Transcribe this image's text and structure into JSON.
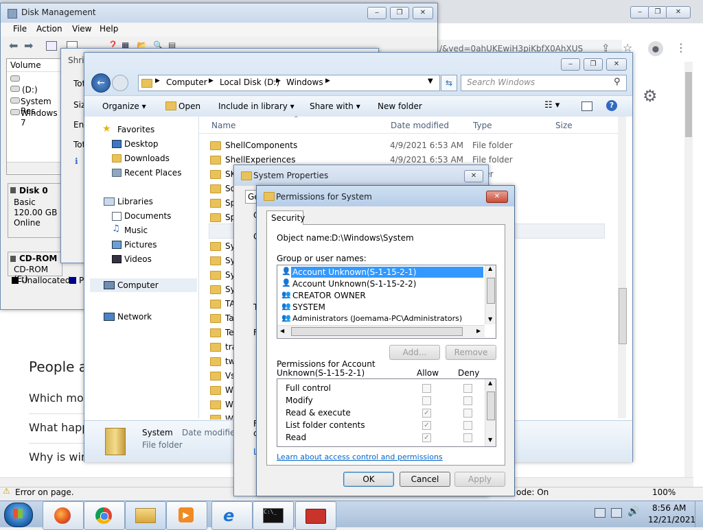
{
  "browser": {
    "url_fragment": "/&ved=0ahUKEwiH3piKbfX0AhXUS",
    "people_heading": "People a",
    "questions": [
      "Which mon",
      "What happe",
      "Why is wint"
    ],
    "status_left": "Error on page.",
    "status_right": "ode: On",
    "zoom": "100%"
  },
  "disk_mgmt": {
    "title": "Disk Management",
    "menu": [
      "File",
      "Action",
      "View",
      "Help"
    ],
    "volume_header": "Volume",
    "volumes": [
      "",
      "(D:)",
      "System Res",
      "Windows 7"
    ],
    "disk0": {
      "name": "Disk 0",
      "type": "Basic",
      "size": "120.00 GB",
      "status": "Online"
    },
    "cdrom": {
      "name": "CD-ROM",
      "drive": "CD-ROM (E:)"
    },
    "legend": [
      "Unallocated",
      "P"
    ]
  },
  "shrink": {
    "title": "Shri",
    "labels": [
      "Tot",
      "Size",
      "Ent",
      "Tot"
    ]
  },
  "explorer": {
    "path": [
      "Computer",
      "Local Disk (D:)",
      "Windows"
    ],
    "search_placeholder": "Search Windows",
    "toolbar": {
      "organize": "Organize",
      "open": "Open",
      "include": "Include in library",
      "share": "Share with",
      "new_folder": "New folder"
    },
    "nav": {
      "favorites": "Favorites",
      "fav_items": [
        "Desktop",
        "Downloads",
        "Recent Places"
      ],
      "libraries": "Libraries",
      "lib_items": [
        "Documents",
        "Music",
        "Pictures",
        "Videos"
      ],
      "computer": "Computer",
      "network": "Network"
    },
    "columns": {
      "name": "Name",
      "date": "Date modified",
      "type": "Type",
      "size": "Size"
    },
    "files": [
      {
        "name": "ShellComponents",
        "date": "4/9/2021 6:53 AM",
        "type": "File folder"
      },
      {
        "name": "ShellExperiences",
        "date": "4/9/2021 6:53 AM",
        "type": "File folder"
      },
      {
        "name": "SK",
        "date": "",
        "type": "older"
      },
      {
        "name": "So",
        "date": "",
        "type": ""
      },
      {
        "name": "Sp",
        "date": "",
        "type": ""
      },
      {
        "name": "Sp",
        "date": "",
        "type": ""
      },
      {
        "name": "Sy",
        "date": "",
        "type": ""
      },
      {
        "name": "Sy",
        "date": "",
        "type": ""
      },
      {
        "name": "Sy",
        "date": "",
        "type": ""
      },
      {
        "name": "Sy",
        "date": "",
        "type": ""
      },
      {
        "name": "Sy",
        "date": "",
        "type": ""
      },
      {
        "name": "TA",
        "date": "",
        "type": ""
      },
      {
        "name": "Ta",
        "date": "",
        "type": ""
      },
      {
        "name": "Te",
        "date": "",
        "type": ""
      },
      {
        "name": "tra",
        "date": "",
        "type": ""
      },
      {
        "name": "tw",
        "date": "",
        "type": ""
      },
      {
        "name": "Vs",
        "date": "",
        "type": ""
      },
      {
        "name": "W",
        "date": "",
        "type": ""
      },
      {
        "name": "W",
        "date": "",
        "type": ""
      },
      {
        "name": "W",
        "date": "",
        "type": ""
      }
    ],
    "details": {
      "name": "System",
      "date_label": "Date modified",
      "type": "File folder"
    }
  },
  "sysprops": {
    "title": "System Properties",
    "tab": "Ge",
    "frag": [
      "C",
      "G",
      "T",
      "F",
      "F",
      "c",
      "L"
    ]
  },
  "perm": {
    "title": "Permissions for System",
    "tab": "Security",
    "object_label": "Object name:",
    "object_value": "D:\\Windows\\System",
    "group_label": "Group or user names:",
    "users": [
      "Account Unknown(S-1-15-2-1)",
      "Account Unknown(S-1-15-2-2)",
      "CREATOR OWNER",
      "SYSTEM",
      "Administrators (Joemama-PC\\Administrators)"
    ],
    "add": "Add...",
    "remove": "Remove",
    "perm_label_1": "Permissions for Account",
    "perm_label_2": "Unknown(S-1-15-2-1)",
    "allow": "Allow",
    "deny": "Deny",
    "perms": [
      {
        "name": "Full control",
        "allow": false,
        "deny": false
      },
      {
        "name": "Modify",
        "allow": false,
        "deny": false
      },
      {
        "name": "Read & execute",
        "allow": true,
        "deny": false
      },
      {
        "name": "List folder contents",
        "allow": true,
        "deny": false
      },
      {
        "name": "Read",
        "allow": true,
        "deny": false
      }
    ],
    "link": "Learn about access control and permissions",
    "ok": "OK",
    "cancel": "Cancel",
    "apply": "Apply"
  },
  "taskbar": {
    "time": "8:56 AM",
    "date": "12/21/2021",
    "apps": [
      "firefox-icon",
      "chrome-icon",
      "explorer-icon",
      "media-player-icon",
      "ie-icon",
      "cmd-icon",
      "toolbox-icon"
    ]
  }
}
